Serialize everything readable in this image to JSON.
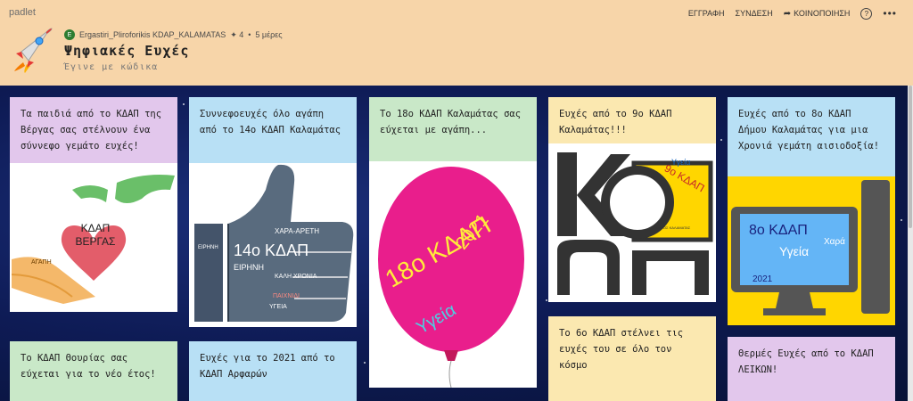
{
  "header": {
    "brand": "padlet",
    "nav": {
      "signup": "ΕΓΓΡΑΦΗ",
      "login": "ΣΥΝΔΕΣΗ",
      "share": "ΚΟΙΝΟΠΟΙΗΣΗ",
      "help": "?",
      "more": "•••"
    },
    "author_initial": "E",
    "author": "Ergastiri_Pliroforikis KDAP_KALAMATAS",
    "likes": "✦ 4",
    "age": "5 μέρες",
    "title": "Ψηφιακές Ευχές",
    "subtitle": "Έγινε με κώδικα"
  },
  "posts": [
    {
      "id": "p1",
      "caption": "Τα παιδιά από το ΚΔΑΠ της Βέργας σας στέλνουν ένα σύννεφο γεμάτο ευχές!",
      "image_text": "ΚΔΑΠ ΒΕΡΓΑΣ",
      "image_word": "ΑΓΑΠΗ"
    },
    {
      "id": "p2",
      "caption": "Συννεφοευχές όλο αγάπη από το 14ο ΚΔΑΠ Καλαμάτας",
      "image_text": "14ο ΚΔΑΠ",
      "image_words": [
        "ΕΙΡΗΝΗ",
        "ΧΑΡΑ-ΑΡΕΤΗ",
        "ΚΑΛΗ ΧΡΟΝΙΑ",
        "ΠΑΙΧΝΙΔΙ",
        "ΥΓΕΙΑ"
      ]
    },
    {
      "id": "p3",
      "caption": "Το 18ο ΚΔΑΠ Καλαμάτας σας εύχεται με αγάπη...",
      "image_text": "18ο ΚΔΑΠ",
      "image_year": "2021",
      "image_word": "Υγεία"
    },
    {
      "id": "p4",
      "caption": "Ευχές από το 9ο ΚΔΑΠ Καλαμάτας!!!",
      "image_text": "9ο ΚΔΑΠ",
      "image_word": "Υγεία",
      "image_small": "ΔΗΜΟΣ ΚΑΛΑΜΑΤΑΣ"
    },
    {
      "id": "p5",
      "caption": "Ευχές από το 8ο ΚΔΑΠ Δήμου Καλαμάτας για μια Χρονιά γεμάτη αισιοδοξία!",
      "image_text": "8ο ΚΔΑΠ",
      "image_word": "Υγεία",
      "image_word2": "Χαρά",
      "image_year": "2021"
    },
    {
      "id": "p6",
      "caption": "Το ΚΔΑΠ Θουρίας σας εύχεται για το νέο έτος!"
    },
    {
      "id": "p7",
      "caption": "Ευχές για το 2021 από το ΚΔΑΠ Αρφαρών"
    },
    {
      "id": "p8",
      "caption": "Το 6ο ΚΔΑΠ στέλνει τις ευχές του σε όλο τον κόσμο"
    },
    {
      "id": "p9",
      "caption": "Θερμές Ευχές από το ΚΔΑΠ ΛΕΙΚΩΝ!"
    }
  ]
}
